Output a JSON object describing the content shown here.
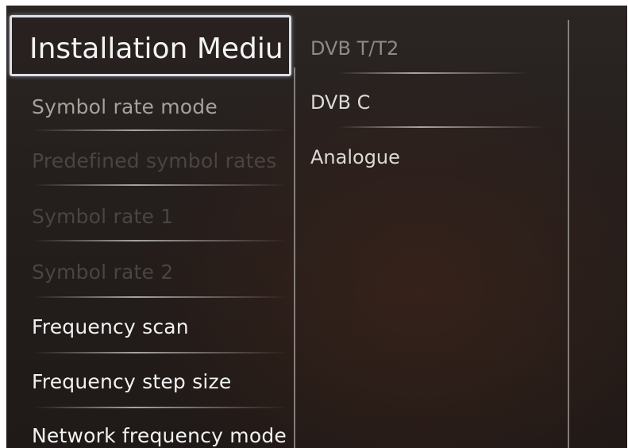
{
  "menu": {
    "selected": {
      "label": "Installation Mediu"
    },
    "items": [
      {
        "label": "Symbol rate mode"
      },
      {
        "label": "Predefined symbol rates"
      },
      {
        "label": "Symbol rate 1"
      },
      {
        "label": "Symbol rate 2"
      },
      {
        "label": "Frequency scan"
      },
      {
        "label": "Frequency step size"
      },
      {
        "label": "Network frequency mode"
      }
    ]
  },
  "options": {
    "items": [
      {
        "label": "DVB T/T2"
      },
      {
        "label": "DVB C"
      },
      {
        "label": "Analogue"
      }
    ]
  }
}
